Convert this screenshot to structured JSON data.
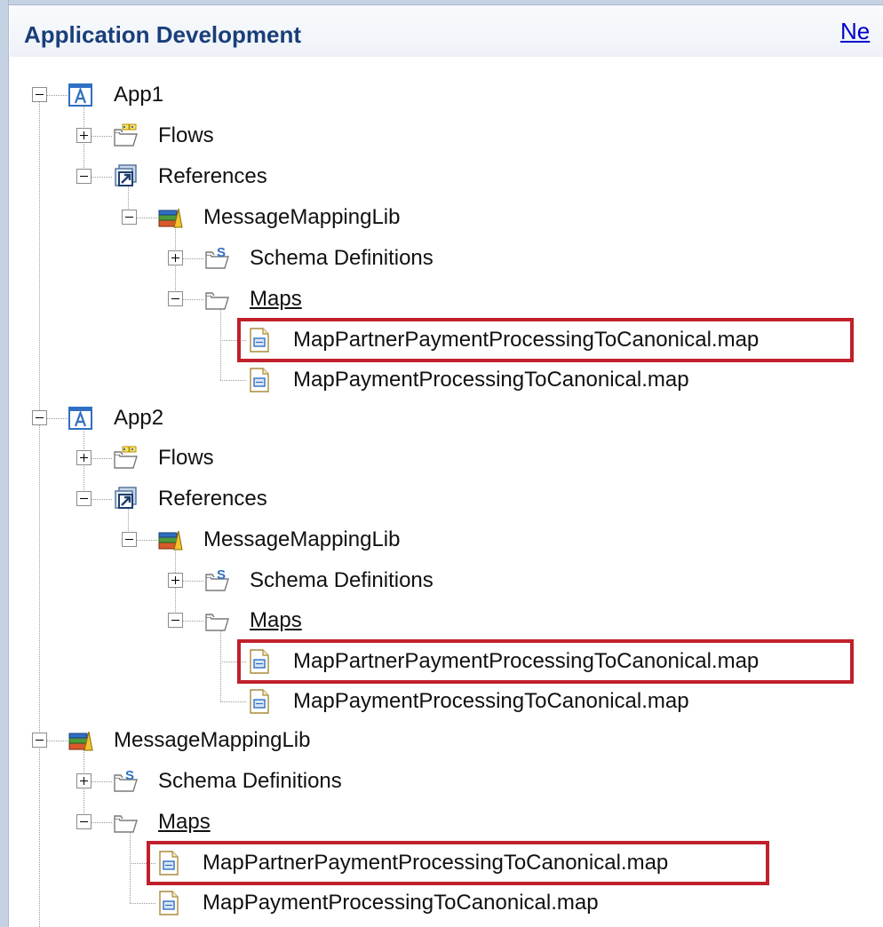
{
  "header": {
    "title": "Application Development",
    "new_link": "Ne"
  },
  "tree": [
    {
      "label": "App1",
      "icon": "application-icon",
      "toggle": "minus"
    },
    {
      "label": "Flows",
      "icon": "flows-folder-icon",
      "toggle": "plus"
    },
    {
      "label": "References",
      "icon": "references-icon",
      "toggle": "minus"
    },
    {
      "label": "MessageMappingLib",
      "icon": "library-icon",
      "toggle": "minus"
    },
    {
      "label": "Schema Definitions",
      "icon": "schema-folder-icon",
      "toggle": "plus"
    },
    {
      "label": "Maps",
      "icon": "maps-folder-icon",
      "toggle": "minus"
    },
    {
      "label": "MapPartnerPaymentProcessingToCanonical.map",
      "icon": "map-file-icon",
      "toggle": "none",
      "highlighted": true
    },
    {
      "label": "MapPaymentProcessingToCanonical.map",
      "icon": "map-file-icon",
      "toggle": "none"
    },
    {
      "label": "App2",
      "icon": "application-icon",
      "toggle": "minus"
    },
    {
      "label": "Flows",
      "icon": "flows-folder-icon",
      "toggle": "plus"
    },
    {
      "label": "References",
      "icon": "references-icon",
      "toggle": "minus"
    },
    {
      "label": "MessageMappingLib",
      "icon": "library-icon",
      "toggle": "minus"
    },
    {
      "label": "Schema Definitions",
      "icon": "schema-folder-icon",
      "toggle": "plus"
    },
    {
      "label": "Maps",
      "icon": "maps-folder-icon",
      "toggle": "minus"
    },
    {
      "label": "MapPartnerPaymentProcessingToCanonical.map",
      "icon": "map-file-icon",
      "toggle": "none",
      "highlighted": true
    },
    {
      "label": "MapPaymentProcessingToCanonical.map",
      "icon": "map-file-icon",
      "toggle": "none"
    },
    {
      "label": "MessageMappingLib",
      "icon": "library-icon",
      "toggle": "minus"
    },
    {
      "label": "Schema Definitions",
      "icon": "schema-folder-icon",
      "toggle": "plus"
    },
    {
      "label": "Maps",
      "icon": "maps-folder-icon",
      "toggle": "minus"
    },
    {
      "label": "MapPartnerPaymentProcessingToCanonical.map",
      "icon": "map-file-icon",
      "toggle": "none",
      "highlighted": true
    },
    {
      "label": "MapPaymentProcessingToCanonical.map",
      "icon": "map-file-icon",
      "toggle": "none"
    }
  ],
  "colors": {
    "title": "#1a3e7a",
    "link": "#0000cc",
    "highlight_border": "#c0202b",
    "frame": "#c5d2e3"
  }
}
